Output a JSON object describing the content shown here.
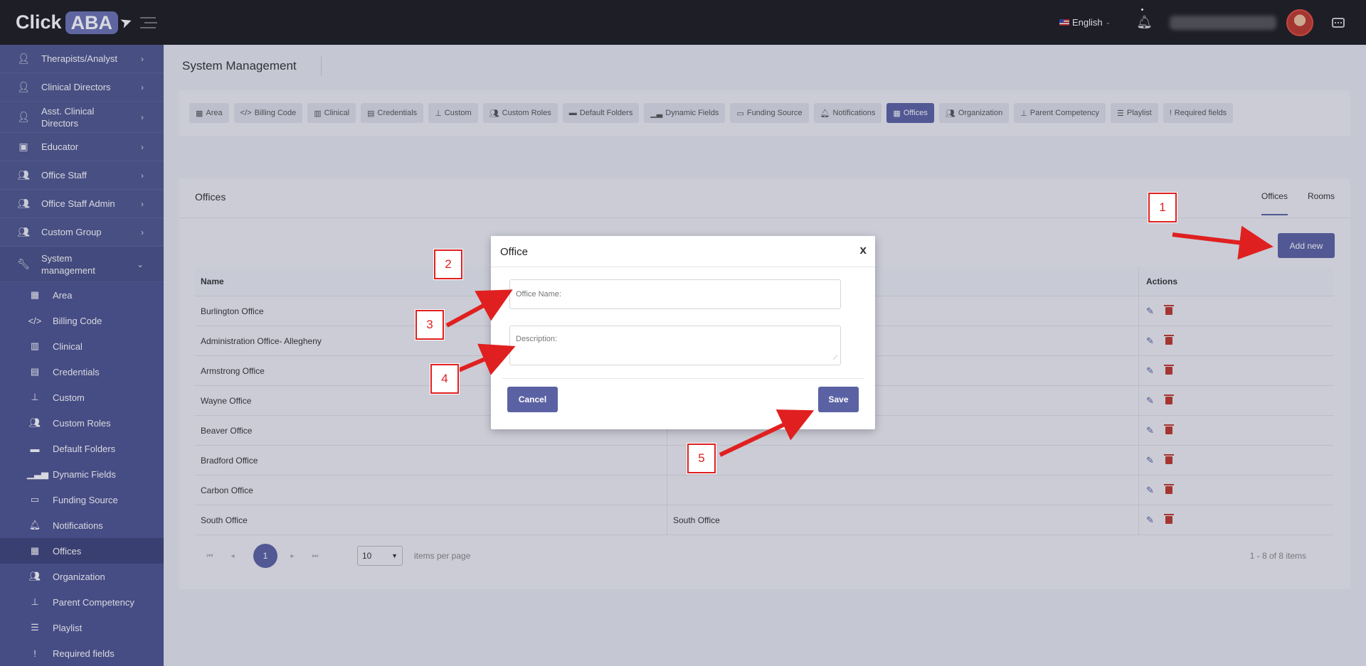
{
  "header": {
    "logo_click": "Click",
    "logo_aba": "ABA",
    "language": "English"
  },
  "sidebar": {
    "items": [
      {
        "label": "Therapists/Analyst",
        "icon": "user-tie-icon"
      },
      {
        "label": "Clinical Directors",
        "icon": "user-tie-icon"
      },
      {
        "label": "Asst. Clinical Directors",
        "icon": "user-tie-icon"
      },
      {
        "label": "Educator",
        "icon": "teacher-icon"
      },
      {
        "label": "Office Staff",
        "icon": "users-icon"
      },
      {
        "label": "Office Staff Admin",
        "icon": "users-icon"
      },
      {
        "label": "Custom Group",
        "icon": "group-icon"
      },
      {
        "label": "System management",
        "icon": "wrench-icon"
      }
    ],
    "sub_items": [
      {
        "label": "Area",
        "icon": "map-icon"
      },
      {
        "label": "Billing Code",
        "icon": "code-icon"
      },
      {
        "label": "Clinical",
        "icon": "building-icon"
      },
      {
        "label": "Credentials",
        "icon": "briefcase-icon"
      },
      {
        "label": "Custom",
        "icon": "stamp-icon"
      },
      {
        "label": "Custom Roles",
        "icon": "users-icon"
      },
      {
        "label": "Default Folders",
        "icon": "folder-icon"
      },
      {
        "label": "Dynamic Fields",
        "icon": "chart-icon"
      },
      {
        "label": "Funding Source",
        "icon": "card-icon"
      },
      {
        "label": "Notifications",
        "icon": "bell-icon"
      },
      {
        "label": "Offices",
        "icon": "office-icon"
      },
      {
        "label": "Organization",
        "icon": "users-icon"
      },
      {
        "label": "Parent Competency",
        "icon": "stamp-icon"
      },
      {
        "label": "Playlist",
        "icon": "list-icon"
      },
      {
        "label": "Required fields",
        "icon": "exclamation-icon"
      }
    ]
  },
  "page": {
    "title": "System Management"
  },
  "tabs": [
    "Area",
    "Billing Code",
    "Clinical",
    "Credentials",
    "Custom",
    "Custom Roles",
    "Default Folders",
    "Dynamic Fields",
    "Funding Source",
    "Notifications",
    "Offices",
    "Organization",
    "Parent Competency",
    "Playlist",
    "Required fields"
  ],
  "offices_card": {
    "title": "Offices",
    "tab_offices": "Offices",
    "tab_rooms": "Rooms",
    "add_button": "Add new",
    "columns": [
      "Name",
      "",
      "Actions"
    ],
    "rows": [
      {
        "name": "Burlington Office",
        "description": ""
      },
      {
        "name": "Administration Office- Allegheny",
        "description": ""
      },
      {
        "name": "Armstrong Office",
        "description": ""
      },
      {
        "name": "Wayne Office",
        "description": ""
      },
      {
        "name": "Beaver Office",
        "description": ""
      },
      {
        "name": "Bradford Office",
        "description": ""
      },
      {
        "name": "Carbon Office",
        "description": ""
      },
      {
        "name": "South Office",
        "description": "South Office"
      }
    ]
  },
  "pager": {
    "page": "1",
    "per_page": "10",
    "per_page_label": "items per page",
    "info": "1 - 8 of 8 items"
  },
  "modal": {
    "title": "Office",
    "close": "x",
    "name_placeholder": "Office Name:",
    "desc_placeholder": "Description:",
    "cancel": "Cancel",
    "save": "Save"
  },
  "callouts": [
    "1",
    "2",
    "3",
    "4",
    "5"
  ],
  "colors": {
    "accent": "#5b62a3",
    "sidebar": "#50578f",
    "annotation": "#e02020"
  }
}
